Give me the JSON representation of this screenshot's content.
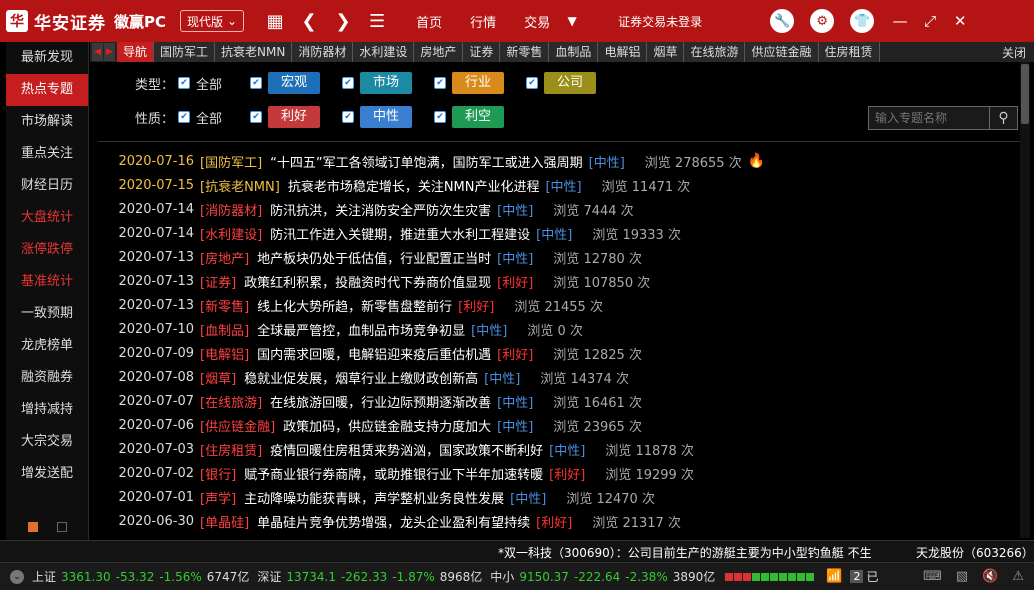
{
  "app": {
    "logo_char": "华",
    "brand_name": "华安证券",
    "product_name": "徽赢PC",
    "version_label": "现代版",
    "login_status": "证券交易未登录"
  },
  "topnav": {
    "items": [
      "首页",
      "行情",
      "交易"
    ]
  },
  "sidebar": {
    "items": [
      {
        "label": "最新发现",
        "state": "normal"
      },
      {
        "label": "热点专题",
        "state": "active"
      },
      {
        "label": "市场解读",
        "state": "normal"
      },
      {
        "label": "重点关注",
        "state": "normal"
      },
      {
        "label": "财经日历",
        "state": "normal"
      },
      {
        "label": "大盘统计",
        "state": "red"
      },
      {
        "label": "涨停跌停",
        "state": "red"
      },
      {
        "label": "基准统计",
        "state": "red"
      },
      {
        "label": "一致预期",
        "state": "normal"
      },
      {
        "label": "龙虎榜单",
        "state": "normal"
      },
      {
        "label": "融资融券",
        "state": "normal"
      },
      {
        "label": "增持减持",
        "state": "normal"
      },
      {
        "label": "大宗交易",
        "state": "normal"
      },
      {
        "label": "增发送配",
        "state": "normal"
      }
    ]
  },
  "tabs": {
    "items": [
      "导航",
      "国防军工",
      "抗衰老NMN",
      "消防器材",
      "水利建设",
      "房地产",
      "证券",
      "新零售",
      "血制品",
      "电解铝",
      "烟草",
      "在线旅游",
      "供应链金融",
      "住房租赁"
    ],
    "active_index": 0,
    "close_label": "关闭"
  },
  "filters": {
    "type_label": "类型：",
    "nature_label": "性质：",
    "all_label": "全部",
    "type_options": [
      {
        "label": "宏观",
        "color": "#1f6fb8"
      },
      {
        "label": "市场",
        "color": "#1b8aa3"
      },
      {
        "label": "行业",
        "color": "#d98a1a"
      },
      {
        "label": "公司",
        "color": "#9a8f1a"
      }
    ],
    "nature_options": [
      {
        "label": "利好",
        "color": "#c43a3a"
      },
      {
        "label": "中性",
        "color": "#3a7fcf"
      },
      {
        "label": "利空",
        "color": "#1f9a55"
      }
    ],
    "search_placeholder": "输入专题名称"
  },
  "colors": {
    "brand_red": "#b51414",
    "neutral": "#4a8fe0",
    "positive": "#ff3030",
    "highlight_date": "#f0c040"
  },
  "articles": [
    {
      "date": "2020-07-16",
      "tag": "[国防军工]",
      "title": "“十四五”军工各领域订单饱满，国防军工或进入强周期",
      "sentiment": "[中性]",
      "views": "浏览 278655 次",
      "hot": true,
      "highlight": true
    },
    {
      "date": "2020-07-15",
      "tag": "[抗衰老NMN]",
      "title": "抗衰老市场稳定增长，关注NMN产业化进程",
      "sentiment": "[中性]",
      "views": "浏览 11471 次",
      "hot": false,
      "highlight": true
    },
    {
      "date": "2020-07-14",
      "tag": "[消防器材]",
      "title": "防汛抗洪，关注消防安全严防次生灾害",
      "sentiment": "[中性]",
      "views": "浏览 7444 次",
      "hot": false,
      "highlight": false
    },
    {
      "date": "2020-07-14",
      "tag": "[水利建设]",
      "title": "防汛工作进入关键期，推进重大水利工程建设",
      "sentiment": "[中性]",
      "views": "浏览 19333 次",
      "hot": false,
      "highlight": false
    },
    {
      "date": "2020-07-13",
      "tag": "[房地产]",
      "title": "地产板块仍处于低估值，行业配置正当时",
      "sentiment": "[中性]",
      "views": "浏览 12780 次",
      "hot": false,
      "highlight": false
    },
    {
      "date": "2020-07-13",
      "tag": "[证券]",
      "title": "政策红利积累，投融资时代下券商价值显现",
      "sentiment": "[利好]",
      "views": "浏览 107850 次",
      "hot": false,
      "highlight": false
    },
    {
      "date": "2020-07-13",
      "tag": "[新零售]",
      "title": "线上化大势所趋，新零售盘整前行",
      "sentiment": "[利好]",
      "views": "浏览 21455 次",
      "hot": false,
      "highlight": false
    },
    {
      "date": "2020-07-10",
      "tag": "[血制品]",
      "title": "全球最严管控，血制品市场竞争初显",
      "sentiment": "[中性]",
      "views": "浏览 0 次",
      "hot": false,
      "highlight": false
    },
    {
      "date": "2020-07-09",
      "tag": "[电解铝]",
      "title": "国内需求回暖，电解铝迎来疫后重估机遇",
      "sentiment": "[利好]",
      "views": "浏览 12825 次",
      "hot": false,
      "highlight": false
    },
    {
      "date": "2020-07-08",
      "tag": "[烟草]",
      "title": "稳就业促发展，烟草行业上缴财政创新高",
      "sentiment": "[中性]",
      "views": "浏览 14374 次",
      "hot": false,
      "highlight": false
    },
    {
      "date": "2020-07-07",
      "tag": "[在线旅游]",
      "title": "在线旅游回暖，行业边际预期逐渐改善",
      "sentiment": "[中性]",
      "views": "浏览 16461 次",
      "hot": false,
      "highlight": false
    },
    {
      "date": "2020-07-06",
      "tag": "[供应链金融]",
      "title": "政策加码，供应链金融支持力度加大",
      "sentiment": "[中性]",
      "views": "浏览 23965 次",
      "hot": false,
      "highlight": false
    },
    {
      "date": "2020-07-03",
      "tag": "[住房租赁]",
      "title": "疫情回暖住房租赁来势汹汹，国家政策不断利好",
      "sentiment": "[中性]",
      "views": "浏览 11878 次",
      "hot": false,
      "highlight": false
    },
    {
      "date": "2020-07-02",
      "tag": "[银行]",
      "title": "赋予商业银行券商牌，或助推银行业下半年加速转暖",
      "sentiment": "[利好]",
      "views": "浏览 19299 次",
      "hot": false,
      "highlight": false
    },
    {
      "date": "2020-07-01",
      "tag": "[声学]",
      "title": "主动降噪功能获青睐，声学整机业务良性发展",
      "sentiment": "[中性]",
      "views": "浏览 12470 次",
      "hot": false,
      "highlight": false
    },
    {
      "date": "2020-06-30",
      "tag": "[单晶硅]",
      "title": "单晶硅片竞争优势增强，龙头企业盈利有望持续",
      "sentiment": "[利好]",
      "views": "浏览 21317 次",
      "hot": false,
      "highlight": false
    }
  ],
  "ticker": {
    "text": "*双一科技（300690）：公司目前生产的游艇主要为中小型钓鱼艇 不生",
    "text2": "天龙股份（603266）"
  },
  "status": {
    "indices": [
      {
        "name": "上证",
        "value": "3361.30",
        "change": "-53.32",
        "pct": "-1.56%",
        "amount": "6747亿"
      },
      {
        "name": "深证",
        "value": "13734.1",
        "change": "-262.33",
        "pct": "-1.87%",
        "amount": "8968亿"
      },
      {
        "name": "中小",
        "value": "9150.37",
        "change": "-222.64",
        "pct": "-2.38%",
        "amount": "3890亿"
      }
    ],
    "connection_count": "2",
    "connection_suffix": "已"
  }
}
